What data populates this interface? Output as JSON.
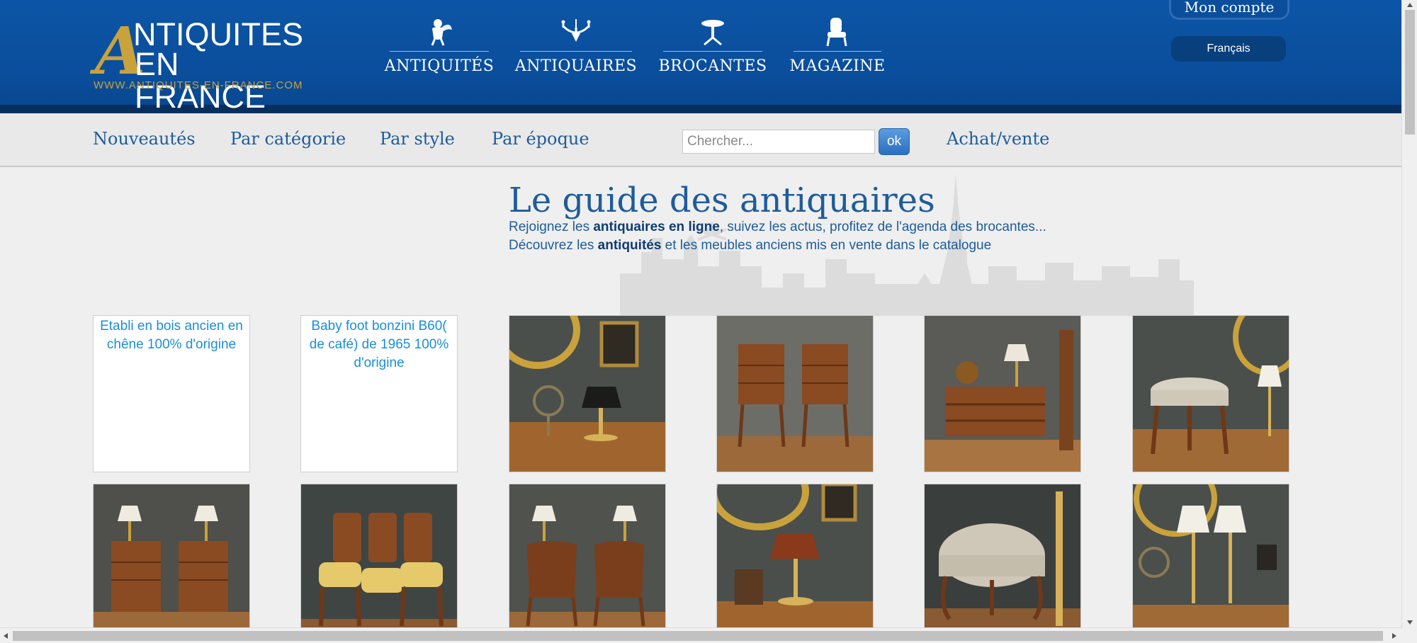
{
  "logo": {
    "big_letter": "A",
    "line1": "NTIQUITES",
    "line2": "EN FRANCE",
    "url": "WWW.ANTIQUITES-EN-FRANCE.COM"
  },
  "main_nav": [
    {
      "label": "ANTIQUITÉS",
      "icon": "cherub-icon"
    },
    {
      "label": "ANTIQUAIRES",
      "icon": "chandelier-icon"
    },
    {
      "label": "BROCANTES",
      "icon": "gueridon-table-icon"
    },
    {
      "label": "MAGAZINE",
      "icon": "armchair-icon"
    }
  ],
  "account": {
    "label": "Mon compte"
  },
  "language": {
    "label": "Français"
  },
  "sub_nav": {
    "nouveautes": "Nouveautés",
    "par_categorie": "Par catégorie",
    "par_style": "Par style",
    "par_epoque": "Par époque",
    "achat_vente": "Achat/vente"
  },
  "search": {
    "placeholder": "Chercher...",
    "button": "ok"
  },
  "hero": {
    "title": "Le guide des antiquaires",
    "line1_a": "Rejoignez les ",
    "line1_b": "antiquaires en ligne",
    "line1_c": ", suivez les actus, profitez de l'agenda des brocantes...",
    "line2_a": "Découvrez les ",
    "line2_b": "antiquités",
    "line2_c": " et les meubles anciens mis en vente dans le catalogue"
  },
  "products": [
    {
      "alt": "Etabli en bois ancien en chêne 100% d'origine",
      "broken": true
    },
    {
      "alt": "Baby foot bonzini B60( de café) de 1965 100% d'origine",
      "broken": true
    },
    {
      "scene": "bouillotte-lamp"
    },
    {
      "scene": "pair-bedside-tables"
    },
    {
      "scene": "side-table-lamp"
    },
    {
      "scene": "stool-lamp"
    },
    {
      "scene": "pair-bedside-lamps"
    },
    {
      "scene": "dining-chairs"
    },
    {
      "scene": "pair-commodes"
    },
    {
      "scene": "bouillotte-lamp-red"
    },
    {
      "scene": "upholstered-stool"
    },
    {
      "scene": "pair-candlestick-lamps"
    }
  ],
  "colors": {
    "header_blue": "#0a4e9c",
    "gold": "#c9a23c",
    "link_blue": "#1e5c9a"
  }
}
